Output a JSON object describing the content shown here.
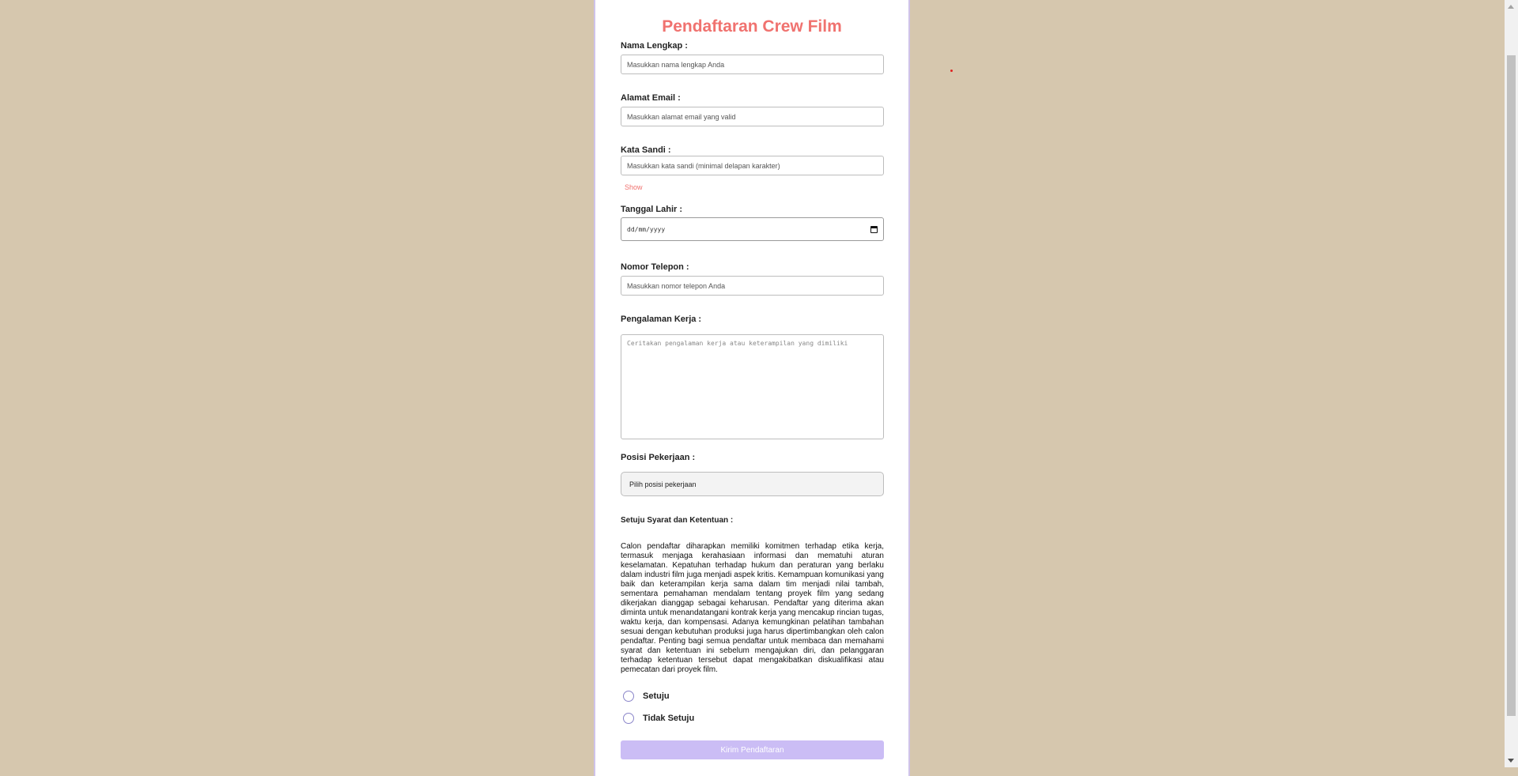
{
  "form": {
    "title": "Pendaftaran Crew Film",
    "name_label": "Nama Lengkap :",
    "name_placeholder": "Masukkan nama lengkap Anda",
    "email_label": "Alamat Email :",
    "email_placeholder": "Masukkan alamat email yang valid",
    "password_label": "Kata Sandi :",
    "password_placeholder": "Masukkan kata sandi (minimal delapan karakter)",
    "show_label": "Show",
    "birth_label": "Tanggal Lahir :",
    "birth_value": "dd/mm/yyyy",
    "phone_label": "Nomor Telepon :",
    "phone_placeholder": "Masukkan nomor telepon Anda",
    "experience_label": "Pengalaman Kerja :",
    "experience_placeholder": "Ceritakan pengalaman kerja atau keterampilan yang dimiliki",
    "position_label": "Posisi Pekerjaan :",
    "position_selected": "Pilih posisi pekerjaan",
    "terms_label": "Setuju Syarat dan Ketentuan :",
    "terms_text": "Calon pendaftar diharapkan memiliki komitmen terhadap etika kerja, termasuk menjaga kerahasiaan informasi dan mematuhi aturan keselamatan. Kepatuhan terhadap hukum dan peraturan yang berlaku dalam industri film juga menjadi aspek kritis. Kemampuan komunikasi yang baik dan keterampilan kerja sama dalam tim menjadi nilai tambah, sementara pemahaman mendalam tentang proyek film yang sedang dikerjakan dianggap sebagai keharusan. Pendaftar yang diterima akan diminta untuk menandatangani kontrak kerja yang mencakup rincian tugas, waktu kerja, dan kompensasi. Adanya kemungkinan pelatihan tambahan sesuai dengan kebutuhan produksi juga harus dipertimbangkan oleh calon pendaftar. Penting bagi semua pendaftar untuk membaca dan memahami syarat dan ketentuan ini sebelum mengajukan diri, dan pelanggaran terhadap ketentuan tersebut dapat mengakibatkan diskualifikasi atau pemecatan dari proyek film.",
    "agree_label": "Setuju",
    "disagree_label": "Tidak Setuju",
    "submit_label": "Kirim Pendaftaran"
  },
  "colors": {
    "background": "#d6c7ae",
    "accent": "#f0726f",
    "submit": "#cbbdf5"
  }
}
